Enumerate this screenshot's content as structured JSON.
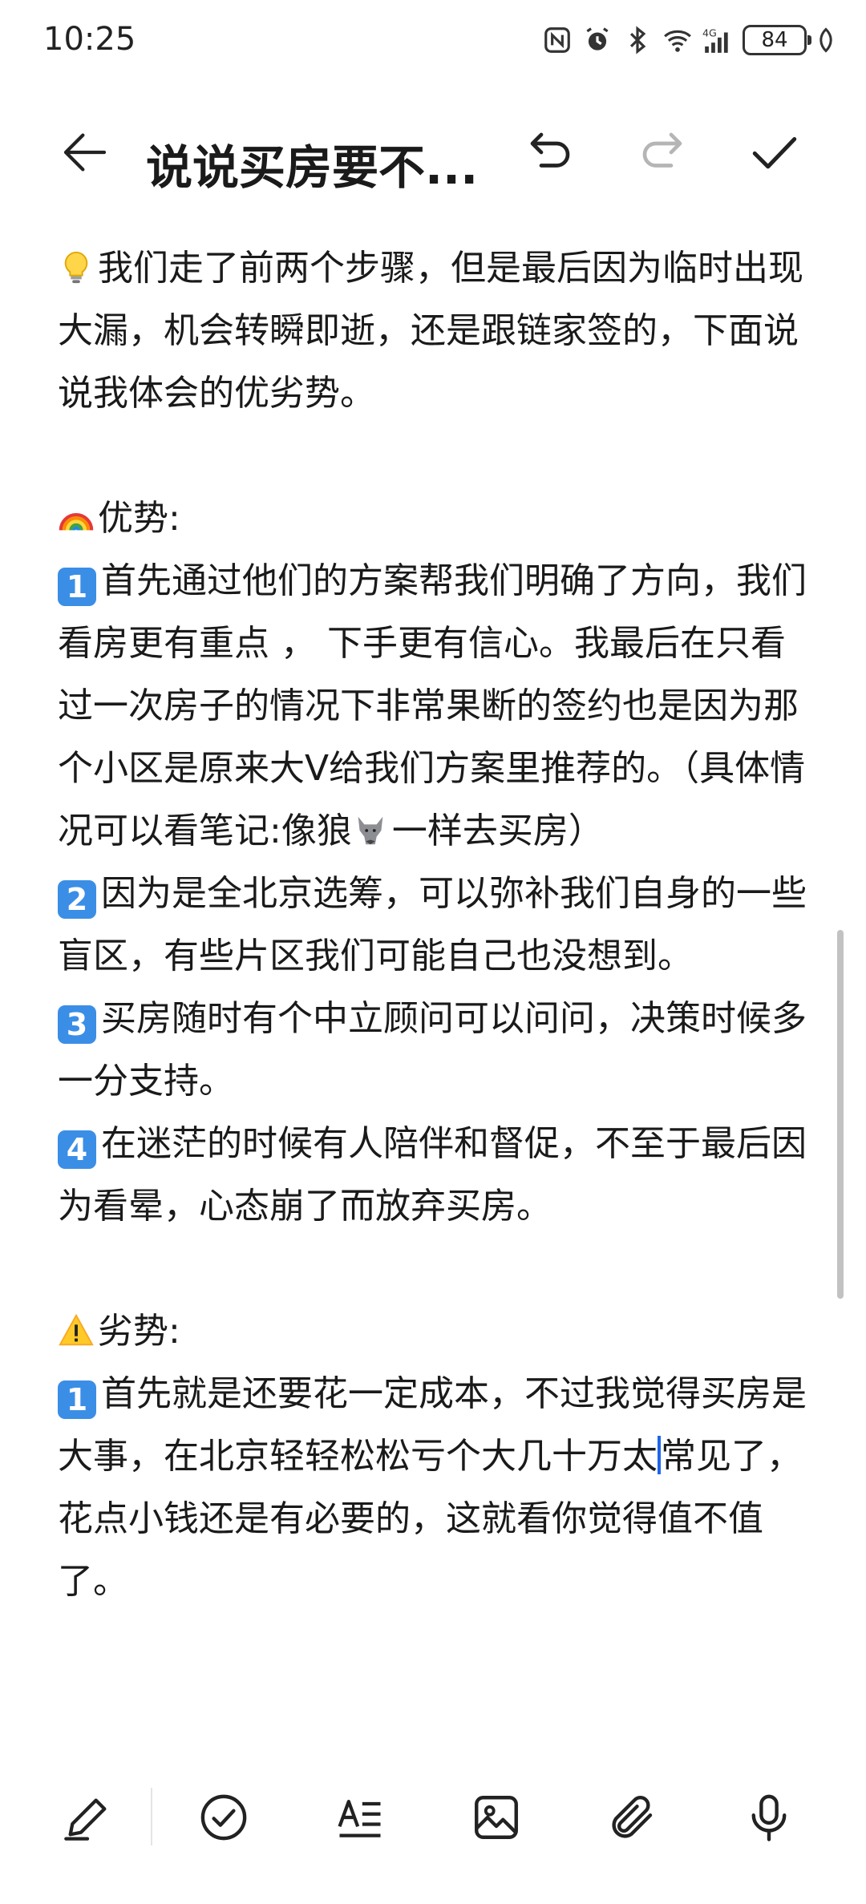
{
  "status_bar": {
    "time": "10:25",
    "battery": "84",
    "icons": [
      "nfc-icon",
      "alarm-icon",
      "bluetooth-icon",
      "wifi-icon",
      "signal-4g-icon",
      "battery-icon",
      "leaf-icon"
    ]
  },
  "toolbar": {
    "title": "说说买房要不...",
    "icons": [
      "back-arrow-icon",
      "undo-icon",
      "redo-icon",
      "check-icon"
    ]
  },
  "content": {
    "intro": "我们走了前两个步骤，但是最后因为临时出现大漏，机会转瞬即逝，还是跟链家签的，下面说说我体会的优劣势。",
    "advantages_heading": "优势:",
    "advantages": [
      {
        "num": "1",
        "text": "首先通过他们的方案帮我们明确了方向，我们看房更有重点 ， 下手更有信心。我最后在只看过一次房子的情况下非常果断的签约也是因为那个小区是原来大V给我们方案里推荐的。（具体情况可以看笔记:像狼",
        "text_after": "一样去买房）"
      },
      {
        "num": "2",
        "text": "因为是全北京选筹，可以弥补我们自身的一些盲区，有些片区我们可能自己也没想到。"
      },
      {
        "num": "3",
        "text": "买房随时有个中立顾问可以问问，决策时候多一分支持。"
      },
      {
        "num": "4",
        "text": "在迷茫的时候有人陪伴和督促，不至于最后因为看晕，心态崩了而放弃买房。"
      }
    ],
    "disadvantages_heading": "劣势:",
    "disadvantages": [
      {
        "num": "1",
        "text": "首先就是还要花一定成本，不过我觉得买房是大事，在北京轻轻松松亏个大几十万太",
        "text_after": "常见了，花点小钱还是有必要的，这就看你觉得值不值了。"
      }
    ]
  },
  "bottom_bar": {
    "icons": [
      "pen-icon",
      "checklist-icon",
      "text-format-icon",
      "image-icon",
      "attachment-icon",
      "microphone-icon"
    ]
  },
  "colors": {
    "badge_blue": "#3b8ee6",
    "caret": "#1e66e8",
    "redo_disabled": "#b5b5b5"
  }
}
